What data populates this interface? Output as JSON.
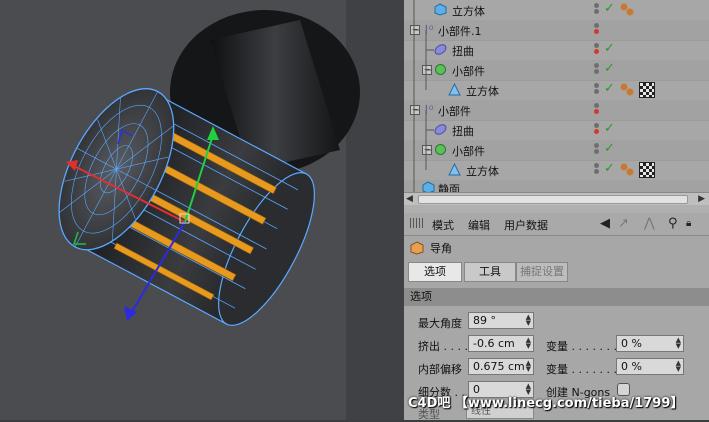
{
  "object_manager": {
    "rows": [
      {
        "name": "立方体",
        "icon": "cube-icon"
      },
      {
        "name": "小部件.1",
        "icon": "null-object-icon"
      },
      {
        "name": "扭曲",
        "icon": "twist-deformer-icon"
      },
      {
        "name": "小部件",
        "icon": "null-object-icon"
      },
      {
        "name": "立方体",
        "icon": "cube-icon"
      },
      {
        "name": "小部件",
        "icon": "null-object-icon"
      },
      {
        "name": "扭曲",
        "icon": "twist-deformer-icon"
      },
      {
        "name": "小部件",
        "icon": "null-object-icon"
      },
      {
        "name": "立方体",
        "icon": "cube-icon"
      },
      {
        "name": "静面",
        "icon": "cube-icon"
      }
    ]
  },
  "attributes": {
    "menu": {
      "mode": "模式",
      "edit": "编辑",
      "user_data": "用户数据"
    },
    "object_title": "导角",
    "tabs": [
      {
        "label": "选项",
        "state": "active"
      },
      {
        "label": "工具",
        "state": "normal"
      },
      {
        "label": "捕捉设置",
        "state": "disabled"
      }
    ],
    "section_title": "选项",
    "fields": {
      "max_angle": {
        "label": "最大角度",
        "value": "89 °"
      },
      "extrude": {
        "label": "挤出 . . . .",
        "value": "-0.6 cm"
      },
      "inner_offset": {
        "label": "内部偏移",
        "value": "0.675 cm"
      },
      "subdivision": {
        "label": "细分数 . .",
        "value": "0"
      },
      "variance1": {
        "label": "变量 . . . . . . . .",
        "value": "0 %"
      },
      "variance2": {
        "label": "变量 . . . . . . . .",
        "value": "0 %"
      },
      "create_ngons": {
        "label": "创建 N-gons",
        "checked": false
      },
      "type": {
        "label": "类型",
        "value": "线性"
      }
    }
  },
  "watermark": {
    "text": "C4D吧 【www.lineсg.com/tieba/1799】"
  },
  "colors": {
    "accent_orange": "#e79a1e",
    "selection_blue": "#5aa8ff",
    "axis_red": "#e03030",
    "axis_green": "#20d040",
    "axis_blue": "#2a2ae0"
  }
}
